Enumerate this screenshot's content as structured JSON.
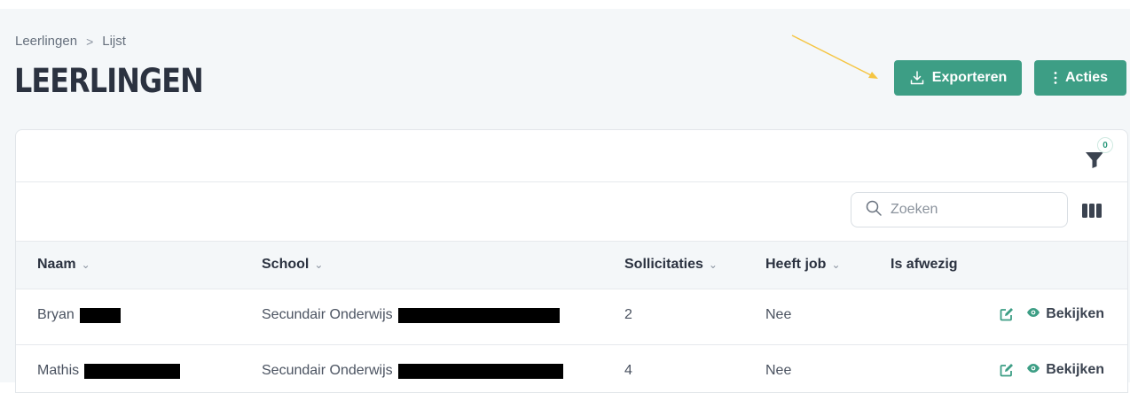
{
  "breadcrumb": {
    "parent": "Leerlingen",
    "separator": ">",
    "current": "Lijst"
  },
  "page_title": "LEERLINGEN",
  "toolbar": {
    "export_label": "Exporteren",
    "actions_label": "Acties"
  },
  "filter": {
    "count": "0"
  },
  "search": {
    "placeholder": "Zoeken"
  },
  "table": {
    "columns": [
      "Naam",
      "School",
      "Sollicitaties",
      "Heeft job",
      "Is afwezig"
    ],
    "rows": [
      {
        "name": "Bryan",
        "school": "Secundair Onderwijs",
        "sollicitaties": "2",
        "heeft_job": "Nee",
        "is_afwezig": "",
        "view_label": "Bekijken"
      },
      {
        "name": "Mathis",
        "school": "Secundair Onderwijs",
        "sollicitaties": "4",
        "heeft_job": "Nee",
        "is_afwezig": "",
        "view_label": "Bekijken"
      }
    ]
  },
  "colors": {
    "accent": "#3d9e85",
    "annotation_arrow": "#f5c542",
    "background": "#f4f7f9"
  },
  "icons": [
    "download-icon",
    "more-vertical-icon",
    "filter-icon",
    "search-icon",
    "columns-icon",
    "edit-icon",
    "eye-icon"
  ]
}
